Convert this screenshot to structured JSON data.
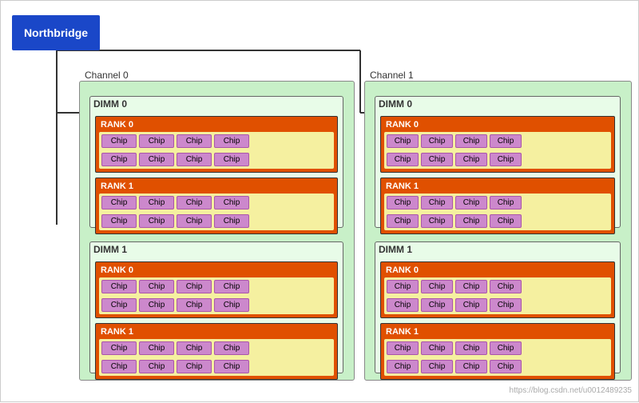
{
  "northbridge": {
    "label": "Northbridge"
  },
  "channels": [
    {
      "label": "Channel 0",
      "dimms": [
        {
          "label": "DIMM 0",
          "ranks": [
            {
              "label": "RANK 0",
              "rows": [
                [
                  "Chip",
                  "Chip",
                  "Chip",
                  "Chip"
                ],
                [
                  "Chip",
                  "Chip",
                  "Chip",
                  "Chip"
                ]
              ]
            },
            {
              "label": "RANK 1",
              "rows": [
                [
                  "Chip",
                  "Chip",
                  "Chip",
                  "Chip"
                ],
                [
                  "Chip",
                  "Chip",
                  "Chip",
                  "Chip"
                ]
              ]
            }
          ]
        },
        {
          "label": "DIMM 1",
          "ranks": [
            {
              "label": "RANK 0",
              "rows": [
                [
                  "Chip",
                  "Chip",
                  "Chip",
                  "Chip"
                ],
                [
                  "Chip",
                  "Chip",
                  "Chip",
                  "Chip"
                ]
              ]
            },
            {
              "label": "RANK 1",
              "rows": [
                [
                  "Chip",
                  "Chip",
                  "Chip",
                  "Chip"
                ],
                [
                  "Chip",
                  "Chip",
                  "Chip",
                  "Chip"
                ]
              ]
            }
          ]
        }
      ]
    },
    {
      "label": "Channel 1",
      "dimms": [
        {
          "label": "DIMM 0",
          "ranks": [
            {
              "label": "RANK 0",
              "rows": [
                [
                  "Chip",
                  "Chip",
                  "Chip",
                  "Chip"
                ],
                [
                  "Chip",
                  "Chip",
                  "Chip",
                  "Chip"
                ]
              ]
            },
            {
              "label": "RANK 1",
              "rows": [
                [
                  "Chip",
                  "Chip",
                  "Chip",
                  "Chip"
                ],
                [
                  "Chip",
                  "Chip",
                  "Chip",
                  "Chip"
                ]
              ]
            }
          ]
        },
        {
          "label": "DIMM 1",
          "ranks": [
            {
              "label": "RANK 0",
              "rows": [
                [
                  "Chip",
                  "Chip",
                  "Chip",
                  "Chip"
                ],
                [
                  "Chip",
                  "Chip",
                  "Chip",
                  "Chip"
                ]
              ]
            },
            {
              "label": "RANK 1",
              "rows": [
                [
                  "Chip",
                  "Chip",
                  "Chip",
                  "Chip"
                ],
                [
                  "Chip",
                  "Chip",
                  "Chip",
                  "Chip"
                ]
              ]
            }
          ]
        }
      ]
    }
  ],
  "watermark": "https://blog.csdn.net/u0012489235"
}
